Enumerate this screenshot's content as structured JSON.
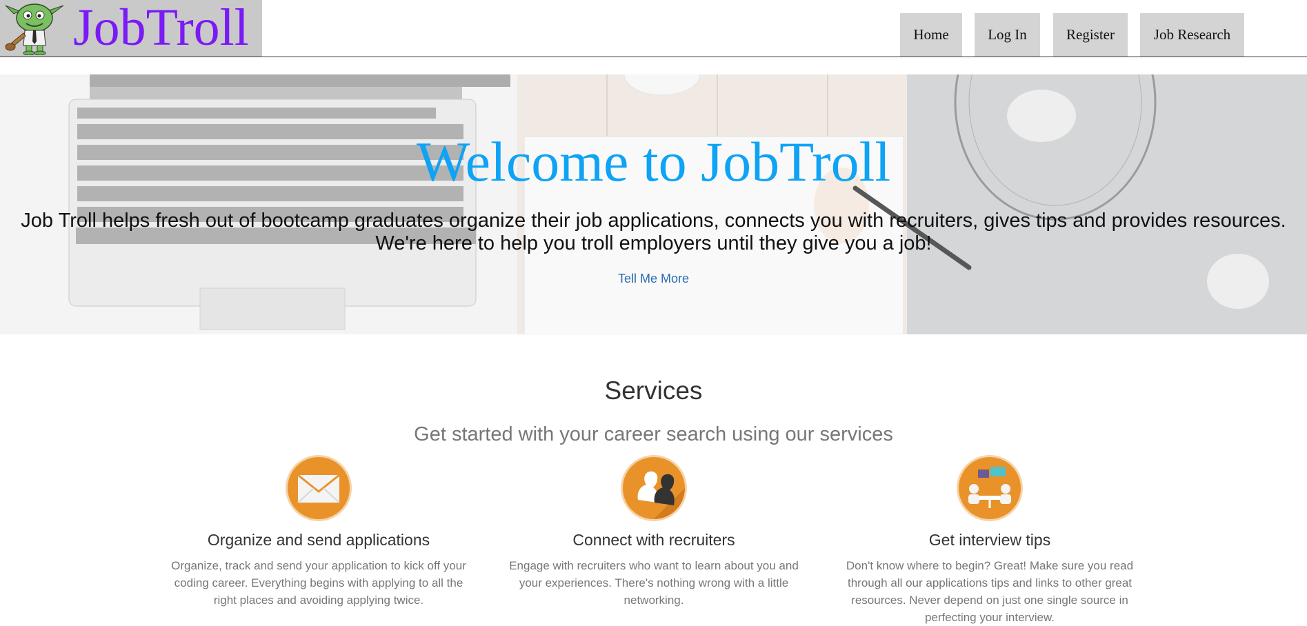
{
  "header": {
    "brand": "JobTroll",
    "nav": [
      {
        "label": "Home"
      },
      {
        "label": "Log In"
      },
      {
        "label": "Register"
      },
      {
        "label": "Job Research"
      }
    ]
  },
  "hero": {
    "title": "Welcome to JobTroll",
    "line1": "Job Troll helps fresh out of bootcamp graduates organize their job applications, connects you with recruiters, gives tips and provides resources.",
    "line2": "We're here to help you troll employers until they give you a job!",
    "cta": "Tell Me More"
  },
  "services": {
    "title": "Services",
    "subtitle": "Get started with your career search using our services",
    "items": [
      {
        "icon": "envelope-icon",
        "title": "Organize and send applications",
        "description": "Organize, track and send your application to kick off your coding career. Everything begins with applying to all the right places and avoiding applying twice."
      },
      {
        "icon": "people-icon",
        "title": "Connect with recruiters",
        "description": "Engage with recruiters who want to learn about you and your experiences. There's nothing wrong with a little networking."
      },
      {
        "icon": "meeting-icon",
        "title": "Get interview tips",
        "description": "Don't know where to begin? Great! Make sure you read through all our applications tips and links to other great resources. Never depend on just one single source in perfecting your interview."
      }
    ]
  },
  "colors": {
    "brand": "#7a1af5",
    "hero_title": "#0ea3f5",
    "link": "#2b6cb0",
    "service_icon": "#e9922a",
    "nav_button": "#d4d4d4"
  }
}
